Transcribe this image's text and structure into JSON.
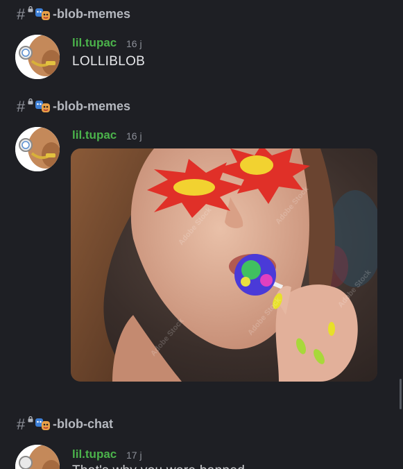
{
  "channels": [
    {
      "name": "-blob-memes"
    },
    {
      "name": "-blob-memes"
    },
    {
      "name": "-blob-chat"
    }
  ],
  "messages": [
    {
      "author": "lil.tupac",
      "time": "16 j",
      "text": "LOLLIBLOB"
    },
    {
      "author": "lil.tupac",
      "time": "16 j",
      "image_watermark": "Adobe Stock"
    },
    {
      "author": "lil.tupac",
      "time": "17 j",
      "text_partial": "That's why you were banned ..."
    }
  ],
  "colors": {
    "background": "#1e1f24",
    "author": "#4bb34b",
    "channel_text": "#b5b8bf",
    "timestamp": "#8d9099"
  },
  "icons": {
    "channel_prefix": "hash-lock-icon",
    "channel_emoji": "masks-emoji-icon",
    "avatar": "blob-avatar-icon"
  }
}
